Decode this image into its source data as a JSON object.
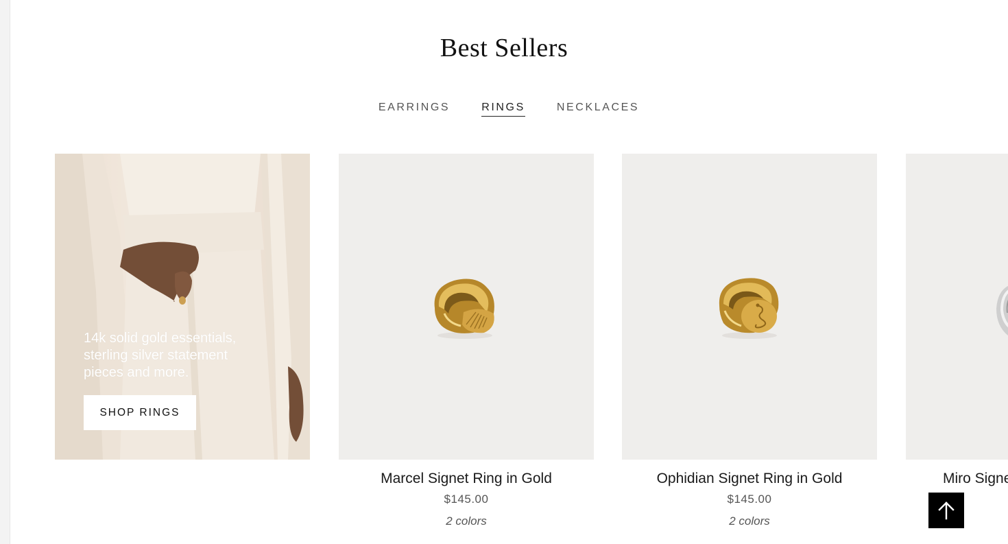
{
  "section": {
    "title": "Best Sellers"
  },
  "tabs": [
    {
      "label": "EARRINGS",
      "active": false
    },
    {
      "label": "RINGS",
      "active": true
    },
    {
      "label": "NECKLACES",
      "active": false
    }
  ],
  "promo": {
    "copy": "14k solid gold essentials, sterling silver statement pieces and more.",
    "button_label": "SHOP RINGS"
  },
  "products": [
    {
      "name": "Marcel Signet Ring in Gold",
      "price": "$145.00",
      "colors": "2 colors",
      "image_icon": "gold-signet-ring-shell"
    },
    {
      "name": "Ophidian Signet Ring in Gold",
      "price": "$145.00",
      "colors": "2 colors",
      "image_icon": "gold-signet-ring-serpent"
    },
    {
      "name": "Miro Signe",
      "price": "",
      "colors": "",
      "image_icon": "silver-signet-ring"
    }
  ],
  "scroll_top": {
    "icon": "arrow-up-icon"
  },
  "colors": {
    "background": "#ffffff",
    "product_bg": "#efeeec",
    "button_dark": "#000000",
    "text": "#1a1a1a",
    "muted": "#555555"
  }
}
